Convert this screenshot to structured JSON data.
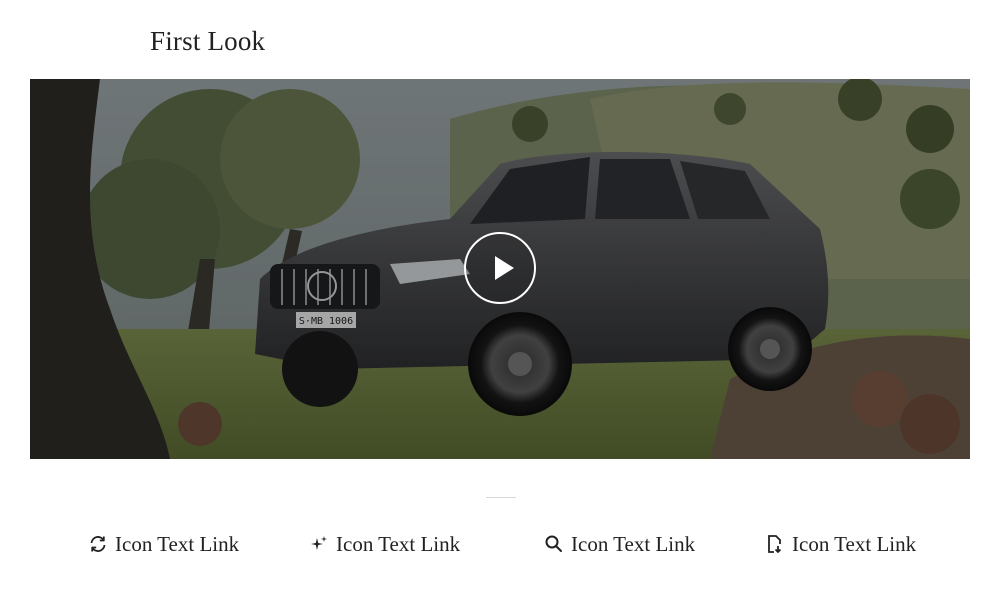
{
  "page": {
    "title": "First Look"
  },
  "hero": {
    "plate_text": "S·MB 1006",
    "play_icon": "play-icon"
  },
  "links": [
    {
      "label": "Icon Text Link",
      "icon": "refresh-icon"
    },
    {
      "label": "Icon Text Link",
      "icon": "sparkle-icon"
    },
    {
      "label": "Icon Text Link",
      "icon": "search-icon"
    },
    {
      "label": "Icon Text Link",
      "icon": "document-download-icon"
    }
  ],
  "colors": {
    "text": "#222222",
    "divider": "#d8d8d8",
    "overlay": "#000000"
  }
}
